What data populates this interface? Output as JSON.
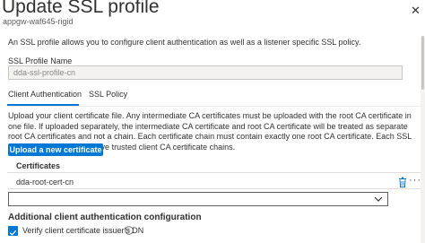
{
  "header": {
    "title": "Update SSL profile",
    "subtitle": "appgw-waf645-rigid",
    "close_glyph": "✕"
  },
  "description": "An SSL profile allows you to configure client authentication as well as a listener specific SSL policy.",
  "profile": {
    "label": "SSL Profile Name",
    "value": "dda-ssl-profile-cn"
  },
  "tabs": [
    {
      "label": "Client Authentication",
      "active": true
    },
    {
      "label": "SSL Policy",
      "active": false
    }
  ],
  "client_auth": {
    "upload_text": "Upload your client certificate file. Any intermediate CA certificates must be uploaded with the root CA certificate in one file. If uploaded separately, the intermediate CA certificate and root CA certificate will be treated as separate root CA certificates and not a chain. Each certificate chain must contain exactly one root CA certificate. Each SSL profile can support up to five trusted client CA certificate chains.",
    "upload_button": "Upload a new certificate",
    "certificates_header": "Certificates",
    "certificates": [
      {
        "name": "dda-root-cert-cn"
      }
    ],
    "more_glyph": "···",
    "select_value": ""
  },
  "additional": {
    "heading": "Additional client authentication configuration",
    "verify_label": "Verify client certificate issuer's DN",
    "verify_checked": true
  },
  "icons": {
    "close": "close-icon",
    "trash": "trash-icon",
    "more": "more-icon",
    "chevron": "chevron-down-icon",
    "check": "checkmark-icon",
    "info": "info-icon"
  },
  "colors": {
    "accent": "#0078d4",
    "text": "#323130",
    "muted": "#605e5c"
  }
}
